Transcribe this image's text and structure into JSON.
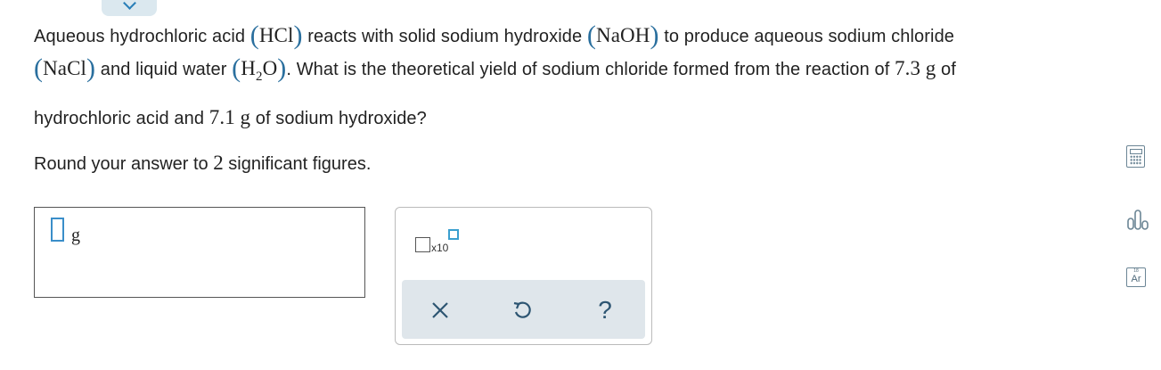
{
  "question": {
    "line1": {
      "t1": "Aqueous hydrochloric acid ",
      "hcl": "HCl",
      "t2": " reacts with solid sodium hydroxide ",
      "naoh": "NaOH",
      "t3": " to produce aqueous sodium chloride"
    },
    "line2": {
      "nacl": "NaCl",
      "t1": " and liquid water ",
      "h": "H",
      "two": "2",
      "o": "O",
      "t2": ". What is the theoretical yield of sodium chloride formed from the reaction of ",
      "mass1": "7.3",
      "unit1": "g",
      "t3": " of"
    },
    "line3": {
      "t1": "hydrochloric acid and ",
      "mass2": "7.1",
      "unit2": "g",
      "t2": " of sodium hydroxide?"
    }
  },
  "instruction": {
    "t1": "Round your answer to ",
    "num": "2",
    "t2": " significant figures."
  },
  "answer": {
    "value": "",
    "unit": "g"
  },
  "toolbar": {
    "x10_label": "x10",
    "clear_symbol": "✕",
    "undo_symbol": "↺",
    "help_symbol": "?"
  },
  "side_tools": {
    "periodic_number": "18",
    "periodic_symbol": "Ar"
  },
  "colors": {
    "accent": "#3a8ec9",
    "paren": "#2a6f9e",
    "toolbar_bg": "#dfe6eb",
    "icon": "#2d5572"
  }
}
